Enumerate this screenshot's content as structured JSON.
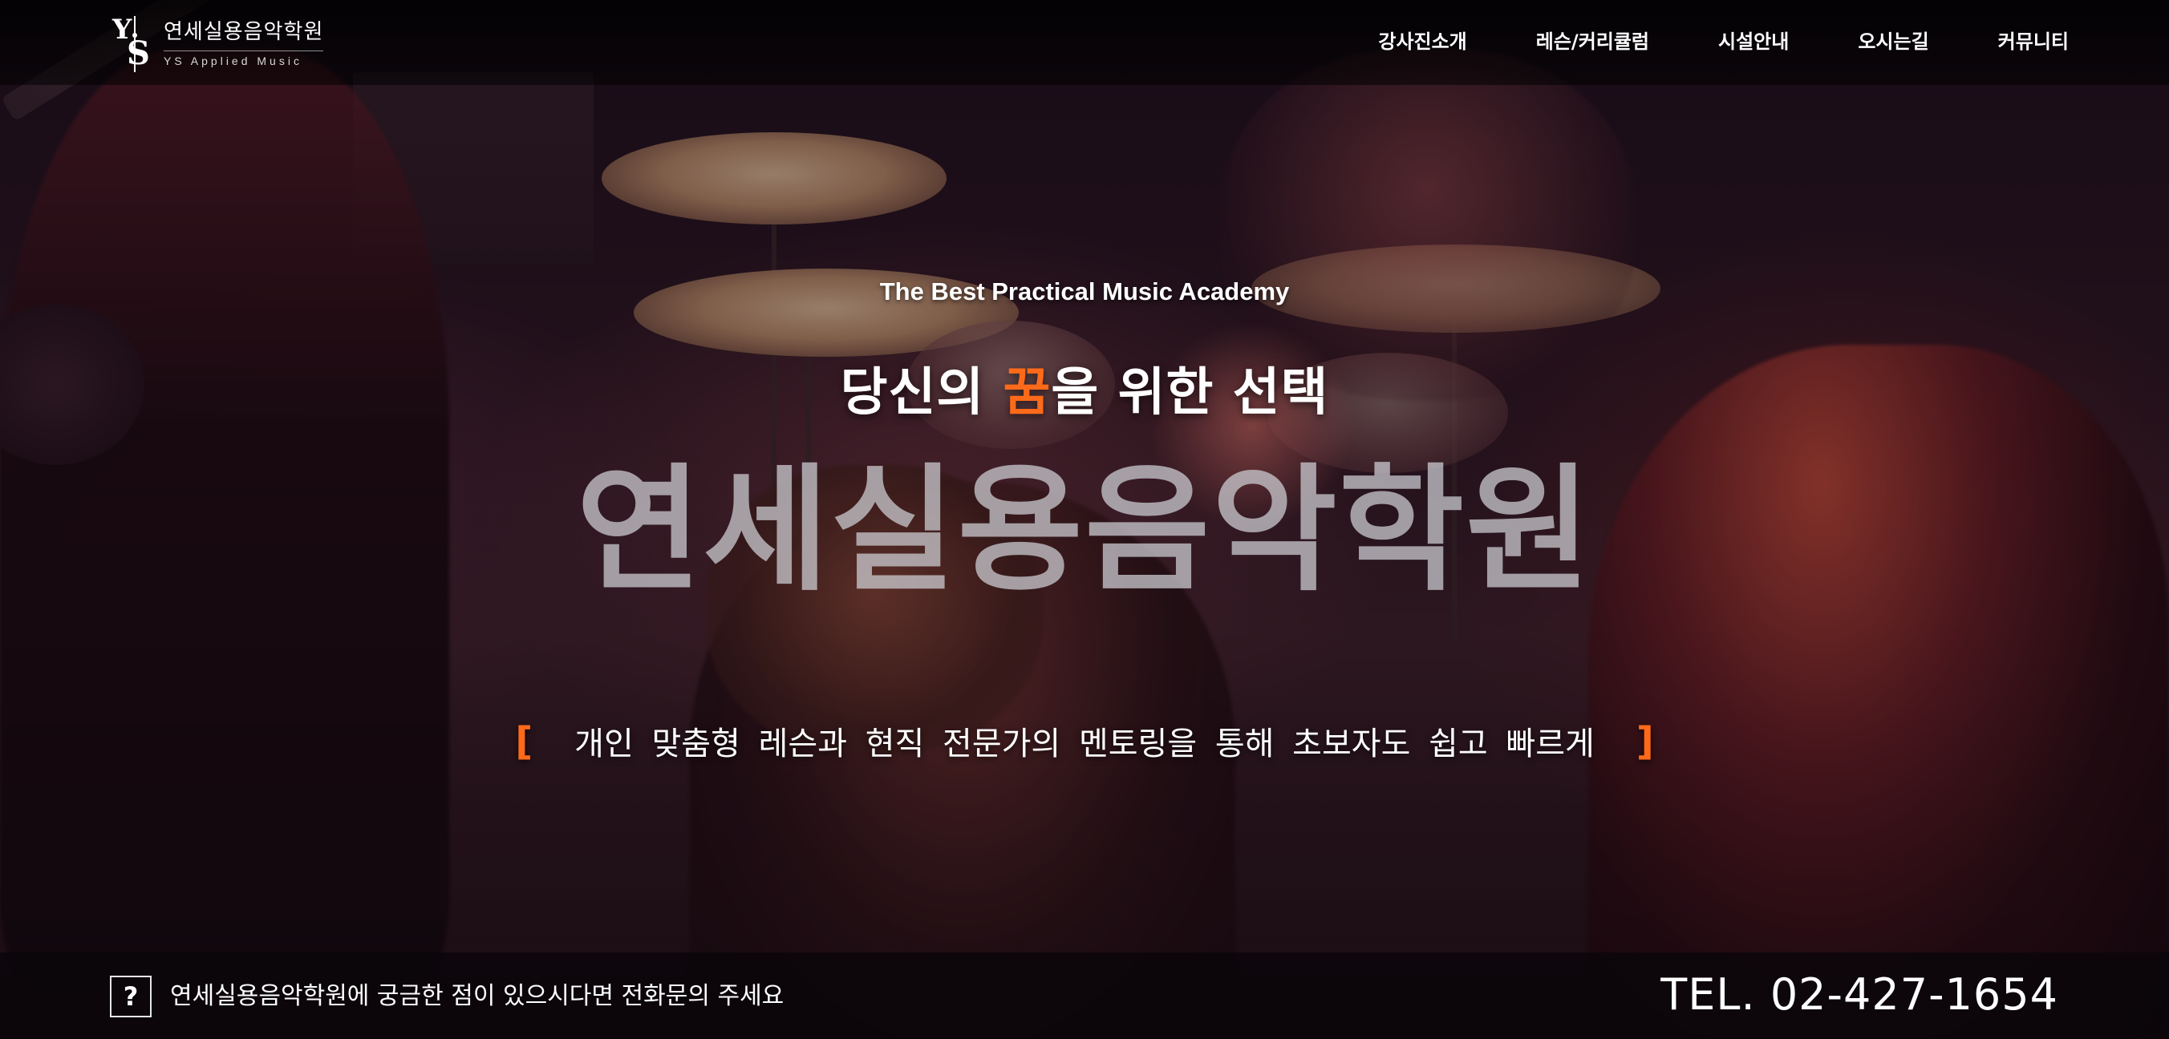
{
  "header": {
    "logo_title": "연세실용음악학원",
    "logo_subtitle": "YS Applied Music",
    "nav": [
      {
        "label": "강사진소개"
      },
      {
        "label": "레슨/커리큘럼"
      },
      {
        "label": "시설안내"
      },
      {
        "label": "오시는길"
      },
      {
        "label": "커뮤니티"
      }
    ]
  },
  "hero": {
    "tagline": "The Best Practical Music Academy",
    "headline_before": "당신의 ",
    "headline_accent": "꿈",
    "headline_after": "을 위한 선택",
    "big_title": "연세실용음악학원",
    "bracket_open": "[",
    "subline": "개인 맞춤형 레슨과 현직 전문가의 멘토링을 통해 초보자도 쉽고 빠르게",
    "bracket_close": "]",
    "accent_color": "#ff6a1a"
  },
  "bottom_bar": {
    "question_mark": "?",
    "message": "연세실용음악학원에 궁금한 점이 있으시다면 전화문의 주세요",
    "tel": "TEL. 02-427-1654"
  }
}
